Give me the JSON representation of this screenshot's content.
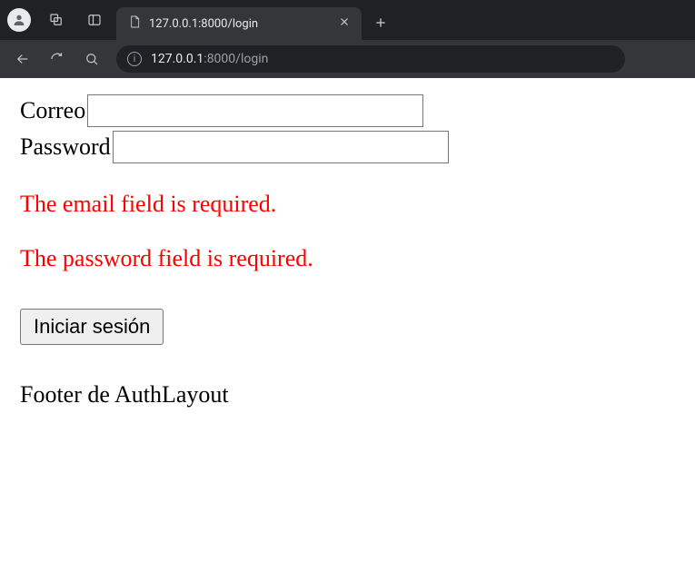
{
  "browser": {
    "tab_title": "127.0.0.1:8000/login",
    "url_host": "127.0.0.1",
    "url_port": ":8000",
    "url_path": "/login"
  },
  "form": {
    "email_label": "Correo",
    "email_value": "",
    "password_label": "Password",
    "password_value": ""
  },
  "errors": {
    "email": "The email field is required.",
    "password": "The password field is required."
  },
  "actions": {
    "login_label": "Iniciar sesión"
  },
  "footer": {
    "text": "Footer de AuthLayout"
  }
}
